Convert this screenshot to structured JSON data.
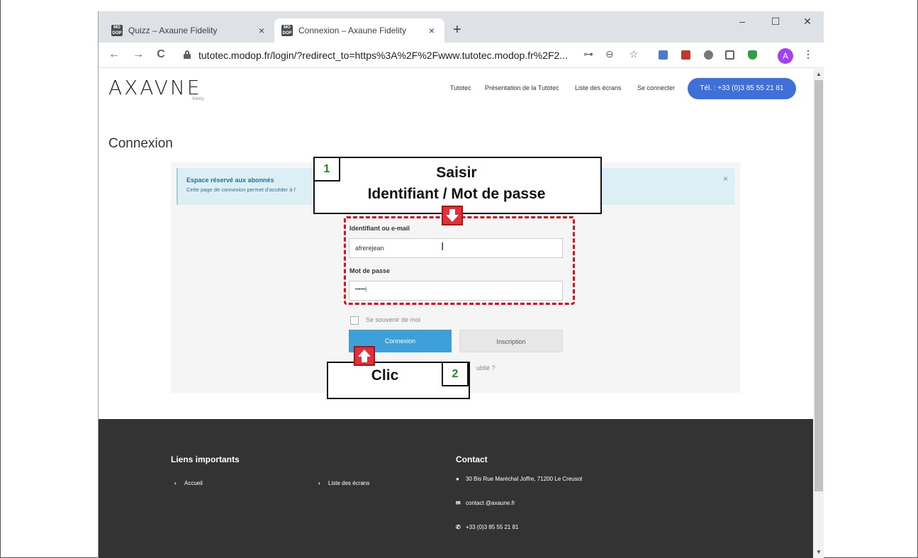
{
  "browser": {
    "tabs": [
      {
        "title": "Quizz – Axaune Fidelity",
        "favicon": "MO DOP",
        "close": "×"
      },
      {
        "title": "Connexion – Axaune Fidelity",
        "favicon": "MO DOP",
        "close": "×"
      }
    ],
    "new_tab": "+",
    "window_controls": {
      "minimize": "–",
      "maximize": "☐",
      "close": "✕"
    },
    "nav": {
      "back": "←",
      "forward": "→",
      "reload": "C"
    },
    "url": "tutotec.modop.fr/login/?redirect_to=https%3A%2F%2Fwww.tutotec.modop.fr%2F2...",
    "toolbar_icons": {
      "key": "⊶",
      "zoom": "⊖",
      "star": "☆",
      "menu": "⋮"
    },
    "avatar": "A"
  },
  "site": {
    "logo": "AXAVNE",
    "logo_sub": "fidelity",
    "nav": [
      "Tutotec",
      "Présentation de la Tutotec",
      "Liste des écrans",
      "Se connecter"
    ],
    "phone_button": "Tél. : +33 (0)3 85 55 21 81"
  },
  "main": {
    "title": "Connexion",
    "alert": {
      "title": "Espace réservé aux abonnés",
      "text": "Cette page de connexion permet d'accéder à l'",
      "close": "×"
    },
    "form": {
      "username_label": "Identifiant ou e-mail",
      "username_value": "afrerejean",
      "password_label": "Mot de passe",
      "password_value": "••••••|",
      "remember": "Se souvenir de moi",
      "login_button": "Connexion",
      "signup_button": "Inscription",
      "forgot": "ublié ?"
    }
  },
  "annotations": {
    "step1_number": "1",
    "step1_line1": "Saisir",
    "step1_line2": "Identifiant / Mot de passe",
    "step2_number": "2",
    "step2_text": "Clic"
  },
  "footer": {
    "links_heading": "Liens importants",
    "links": [
      "Accueil",
      "Liste des écrans"
    ],
    "contact_heading": "Contact",
    "address": "30 Bis Rue Maréchal Joffre, 71200 Le Creusot",
    "email": "contact @axaune.fr",
    "phone": "+33 (0)3 85 55 21 81"
  },
  "colors": {
    "accent_blue": "#3f6fd8",
    "login_button": "#3ea0d8",
    "annotation_red": "#e0101a",
    "step_number_green": "#1a8a1a",
    "footer_bg": "#333333"
  }
}
